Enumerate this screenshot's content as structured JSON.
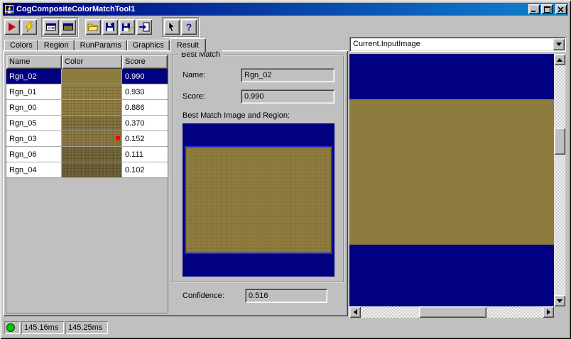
{
  "window": {
    "title": "CogCompositeColorMatchTool1",
    "controls": [
      "minimize",
      "maximize",
      "close"
    ]
  },
  "toolbar": {
    "help_glyph": "?",
    "buttons": [
      {
        "name": "run-button",
        "icon": "run-play-icon"
      },
      {
        "name": "electric-run-button",
        "icon": "lightning-icon"
      },
      {
        "name": "show-last-run-record-button",
        "icon": "record-display-icon"
      },
      {
        "name": "show-current-record-button",
        "icon": "current-record-display-icon"
      },
      {
        "name": "open-button",
        "icon": "folder-open-icon"
      },
      {
        "name": "save-button",
        "icon": "floppy-icon"
      },
      {
        "name": "save-as-button",
        "icon": "floppy-save-as-icon"
      },
      {
        "name": "import-button",
        "icon": "import-arrow-icon"
      },
      {
        "name": "pointer-tool-button",
        "icon": "pointer-icon"
      },
      {
        "name": "help-button",
        "icon": "help-icon"
      }
    ]
  },
  "tabs": [
    {
      "label": "Colors"
    },
    {
      "label": "Region"
    },
    {
      "label": "RunParams"
    },
    {
      "label": "Graphics"
    },
    {
      "label": "Result",
      "active": true
    }
  ],
  "results_table": {
    "columns": [
      "Name",
      "Color",
      "Score"
    ],
    "rows": [
      {
        "name": "Rgn_02",
        "score": "0.990",
        "color_hex": "#8e7c3e",
        "texture": false,
        "selected": true
      },
      {
        "name": "Rgn_01",
        "score": "0.930",
        "color_hex": "#8d7b3d",
        "texture": true
      },
      {
        "name": "Rgn_00",
        "score": "0.886",
        "color_hex": "#8a783c",
        "texture": true
      },
      {
        "name": "Rgn_05",
        "score": "0.370",
        "color_hex": "#7d6e3a",
        "texture": true
      },
      {
        "name": "Rgn_03",
        "score": "0.152",
        "color_hex": "#87753c",
        "texture": true,
        "marker": true
      },
      {
        "name": "Rgn_06",
        "score": "0.111",
        "color_hex": "#6e6136",
        "texture": true
      },
      {
        "name": "Rgn_04",
        "score": "0.102",
        "color_hex": "#695c33",
        "texture": true
      }
    ]
  },
  "best_match": {
    "group_title": "Best Match",
    "name_label": "Name:",
    "name_value": "Rgn_02",
    "score_label": "Score:",
    "score_value": "0.990",
    "image_caption": "Best Match Image and Region:",
    "confidence_label": "Confidence:",
    "confidence_value": "0.516"
  },
  "image_panel": {
    "selected_source": "Current.InputImage"
  },
  "status_bar": {
    "run_time": "145.16ms",
    "total_time": "145.25ms"
  },
  "colors": {
    "titlebar_gradient_start": "#000080",
    "titlebar_gradient_end": "#1084d0",
    "chrome_gray": "#c0c0c0",
    "image_navy": "#000080",
    "image_olive": "#8e7c3e",
    "selection_navy": "#000080",
    "region_outline_blue": "#2a2ad4",
    "indicator_green": "#00c800"
  }
}
